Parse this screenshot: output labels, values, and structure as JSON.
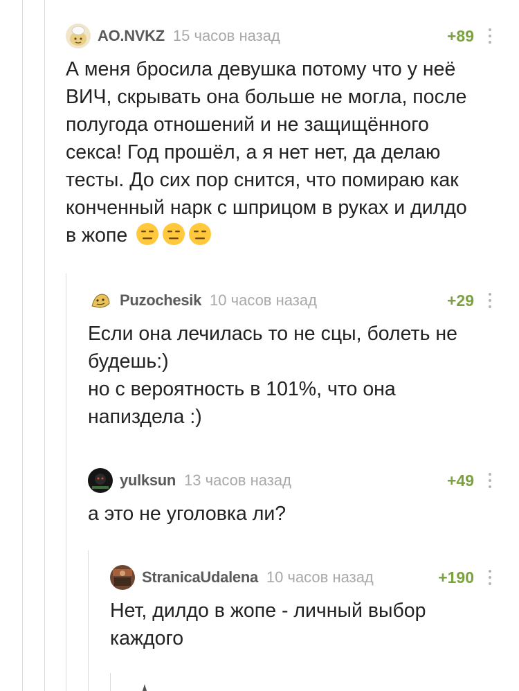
{
  "comments": [
    {
      "username": "AO.NVKZ",
      "time": "15 часов назад",
      "rating": "+89",
      "text": "А меня бросила девушка потому что у неё\nВИЧ, скрывать она больше не могла, после\nполугода отношений и не защищённого\nсекса! Год прошёл, а я нет нет, да делаю\nтесты. До сих пор снится, что помираю как\nконченный нарк с шприцом в руках и дилдо\nв жопе",
      "emoji": [
        "expressionless-face-icon",
        "expressionless-face-icon",
        "expressionless-face-icon"
      ]
    },
    {
      "username": "Puzochesik",
      "time": "10 часов назад",
      "rating": "+29",
      "text": "Если она лечилась то не сцы, болеть не\nбудешь:)\nно с вероятность в 101%, что она\nнапиздела :)"
    },
    {
      "username": "yulksun",
      "time": "13 часов назад",
      "rating": "+49",
      "text": "а это не уголовка ли?"
    },
    {
      "username": "StranicaUdalena",
      "time": "10 часов назад",
      "rating": "+190",
      "text": "Нет, дилдо в жопе - личный выбор\nкаждого"
    }
  ],
  "colors": {
    "rating": "#7ba23f",
    "username": "#5a5a5a",
    "time": "#a8a8a8",
    "thread_line": "#d9d9d9"
  }
}
